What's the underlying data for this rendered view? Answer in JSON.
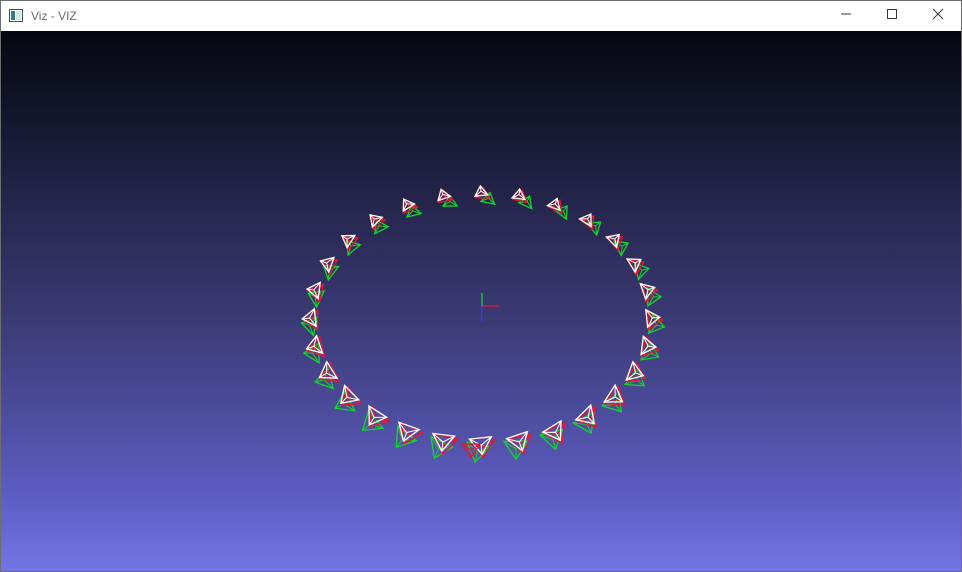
{
  "window": {
    "title": "Viz - VIZ",
    "icons": {
      "app": "viz-app-icon",
      "minimize": "minimize-icon",
      "maximize": "maximize-icon",
      "close": "close-icon"
    }
  },
  "scene": {
    "colors": {
      "gradient_top": "#05070f",
      "gradient_bottom": "#7275e4",
      "ground_truth_camera": "#ffffff",
      "estimated_camera": "#e8162c",
      "reference_camera": "#15d42a",
      "axis_x": "#e8162c",
      "axis_y": "#15d42a",
      "axis_z": "#2f3cff"
    }
  }
}
